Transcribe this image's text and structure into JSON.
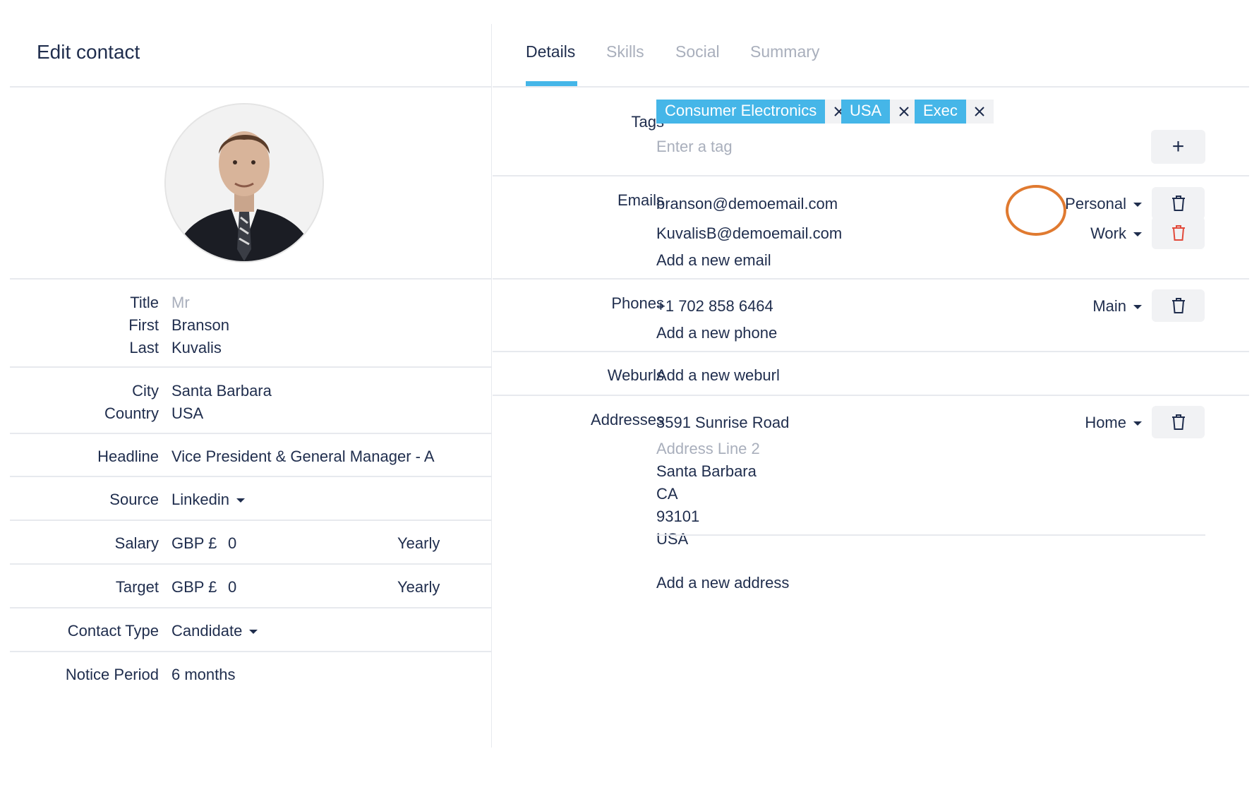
{
  "header": {
    "title": "Edit contact"
  },
  "left": {
    "name": {
      "title_label": "Title",
      "title_value": "Mr",
      "first_label": "First",
      "first_value": "Branson",
      "last_label": "Last",
      "last_value": "Kuvalis"
    },
    "location": {
      "city_label": "City",
      "city_value": "Santa Barbara",
      "country_label": "Country",
      "country_value": "USA"
    },
    "headline": {
      "label": "Headline",
      "value": "Vice President & General Manager - A"
    },
    "source": {
      "label": "Source",
      "value": "Linkedin"
    },
    "salary": {
      "label": "Salary",
      "currency": "GBP £",
      "amount": "0",
      "period": "Yearly"
    },
    "target": {
      "label": "Target",
      "currency": "GBP £",
      "amount": "0",
      "period": "Yearly"
    },
    "contact_type": {
      "label": "Contact Type",
      "value": "Candidate"
    },
    "notice_period": {
      "label": "Notice Period",
      "value": "6 months"
    }
  },
  "tabs": [
    {
      "label": "Details"
    },
    {
      "label": "Skills"
    },
    {
      "label": "Social"
    },
    {
      "label": "Summary"
    }
  ],
  "tags": {
    "label": "Tags",
    "items": [
      "Consumer Electronics",
      "USA",
      "Exec"
    ],
    "placeholder": "Enter a tag",
    "add_symbol": "+"
  },
  "emails": {
    "label": "Emails",
    "items": [
      {
        "value": "branson@demoemail.com",
        "type": "Personal"
      },
      {
        "value": "KuvalisB@demoemail.com",
        "type": "Work"
      }
    ],
    "add_label": "Add a new email"
  },
  "phones": {
    "label": "Phones",
    "items": [
      {
        "value": "+1 702 858 6464",
        "type": "Main"
      }
    ],
    "add_label": "Add a new phone"
  },
  "weburls": {
    "label": "Weburls",
    "add_label": "Add a new weburl"
  },
  "addresses": {
    "label": "Addresses",
    "line1": "3591 Sunrise Road",
    "line2_placeholder": "Address Line 2",
    "city": "Santa Barbara",
    "state": "CA",
    "zip": "93101",
    "country": "USA",
    "type": "Home",
    "add_label": "Add a new address"
  },
  "colors": {
    "accent": "#45b6e8",
    "text": "#1f2d4d",
    "muted": "#a9afbc",
    "danger": "#e24a3b",
    "highlight": "#e07a30"
  }
}
